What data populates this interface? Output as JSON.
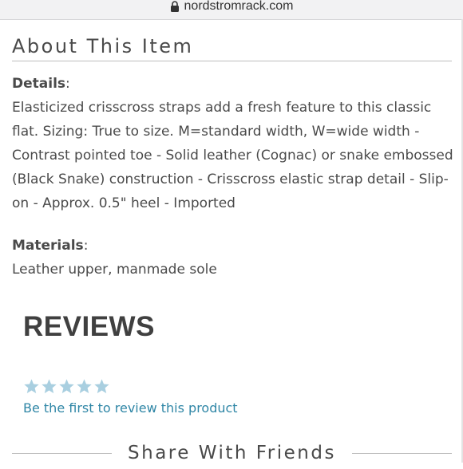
{
  "browser": {
    "url": "nordstromrack.com"
  },
  "about": {
    "title": "About This Item",
    "details_label": "Details",
    "details_text": "Elasticized crisscross straps add a fresh feature to this classic flat. Sizing: True to size. M=standard width, W=wide width - Contrast pointed toe - Solid leather (Cognac) or snake embossed (Black Snake) construction - Crisscross elastic strap detail - Slip-on - Approx. 0.5\" heel - Imported",
    "materials_label": "Materials",
    "materials_text": "Leather upper, manmade sole",
    "colon": ":"
  },
  "reviews": {
    "title": "REVIEWS",
    "rating": 0,
    "max_rating": 5,
    "star_color": "#a9cfe0",
    "link_text": "Be the first to review this product"
  },
  "share": {
    "title": "Share With Friends"
  },
  "colors": {
    "link": "#2f86a6",
    "text": "#4a4a4a"
  }
}
